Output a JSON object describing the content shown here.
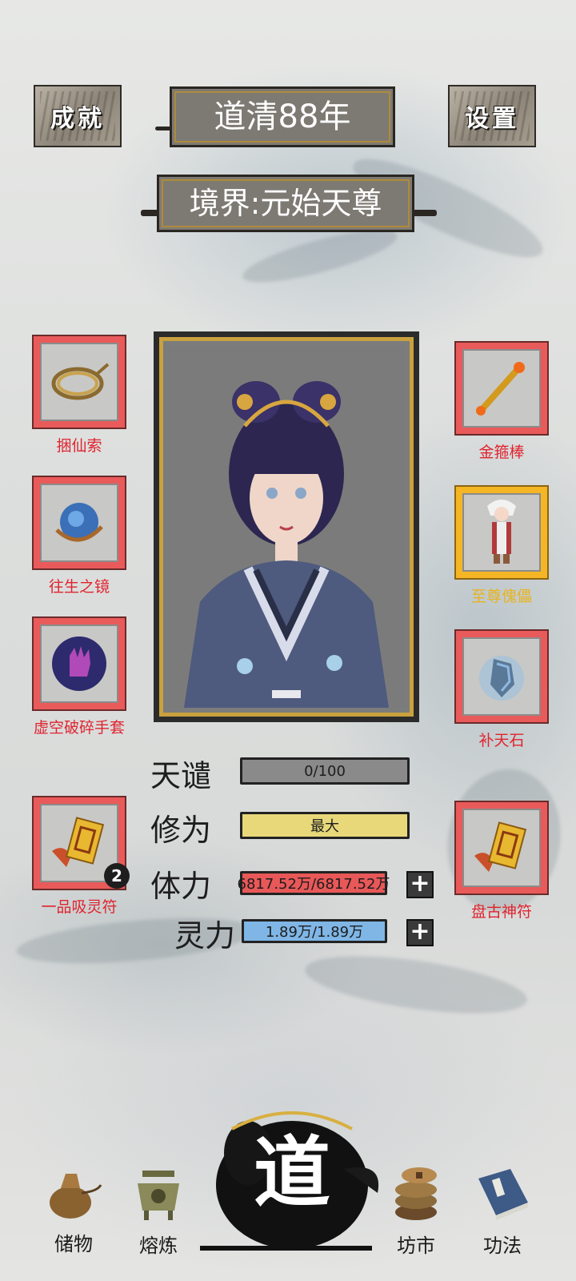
{
  "header": {
    "achievements_label": "成就",
    "year_title": "道清88年",
    "settings_label": "设置",
    "realm_title": "境界:元始天尊"
  },
  "left_slots": [
    {
      "name": "捆仙索",
      "icon": "rope-icon"
    },
    {
      "name": "往生之镜",
      "icon": "mirror-icon"
    },
    {
      "name": "虚空破碎手套",
      "icon": "glove-icon"
    },
    {
      "name": "一品吸灵符",
      "icon": "talisman-icon",
      "count": "2"
    }
  ],
  "right_slots": [
    {
      "name": "金箍棒",
      "icon": "staff-icon"
    },
    {
      "name": "至尊傀儡",
      "icon": "puppet-icon",
      "highlight": "#f5b625"
    },
    {
      "name": "补天石",
      "icon": "crystal-icon"
    },
    {
      "name": "盘古神符",
      "icon": "talisman-icon"
    }
  ],
  "stats": {
    "tribulation": {
      "label": "天谴",
      "value": "0/100",
      "color": "#8a8a8a",
      "fill": 1.0
    },
    "cultivation": {
      "label": "修为",
      "value": "最大",
      "color": "#e8d87a",
      "fill": 1.0
    },
    "stamina": {
      "label": "体力",
      "value": "6817.52万/6817.52万",
      "color": "#e85858",
      "fill": 1.0
    },
    "spirit": {
      "label": "灵力",
      "value": "1.89万/1.89万",
      "color": "#7fb6e6",
      "fill": 1.0
    }
  },
  "nav": {
    "storage": "储物",
    "smelting": "熔炼",
    "dao": "道",
    "market": "坊市",
    "skills": "功法"
  }
}
